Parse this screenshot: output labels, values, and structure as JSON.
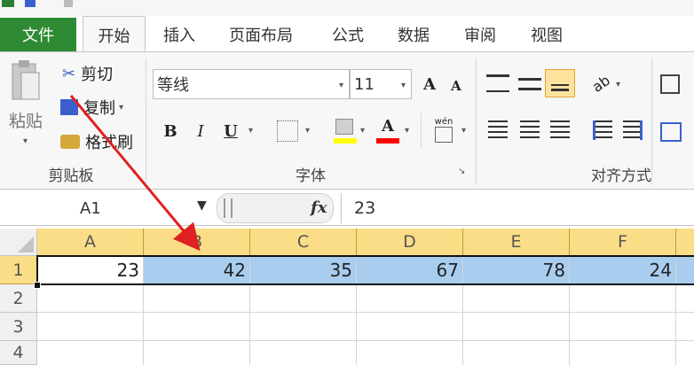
{
  "tabs": {
    "file": "文件",
    "items": [
      "开始",
      "插入",
      "页面布局",
      "公式",
      "数据",
      "审阅",
      "视图"
    ]
  },
  "clipboard": {
    "paste": "粘贴",
    "cut": "剪切",
    "copy": "复制",
    "format_painter": "格式刷",
    "group_label": "剪贴板"
  },
  "font": {
    "name": "等线",
    "size": "11",
    "bold": "B",
    "italic": "I",
    "underline": "U",
    "font_color_glyph": "A",
    "phonetic_glyph": "wén",
    "group_label": "字体"
  },
  "alignment": {
    "group_label": "对齐方式"
  },
  "formula_bar": {
    "name_box": "A1",
    "fx": "fx",
    "content": "23"
  },
  "sheet": {
    "columns": [
      "A",
      "B",
      "C",
      "D",
      "E",
      "F"
    ],
    "rows": [
      "1",
      "2",
      "3",
      "4"
    ],
    "row1_values": [
      "23",
      "42",
      "35",
      "67",
      "78",
      "24"
    ]
  },
  "colors": {
    "file_tab": "#2e8b34",
    "header_highlight": "#fadd86",
    "selection_fill": "#a8cdef",
    "annotation_arrow": "#e02020",
    "font_color_bar": "#ff0000",
    "fill_color_bar": "#ffff00"
  }
}
